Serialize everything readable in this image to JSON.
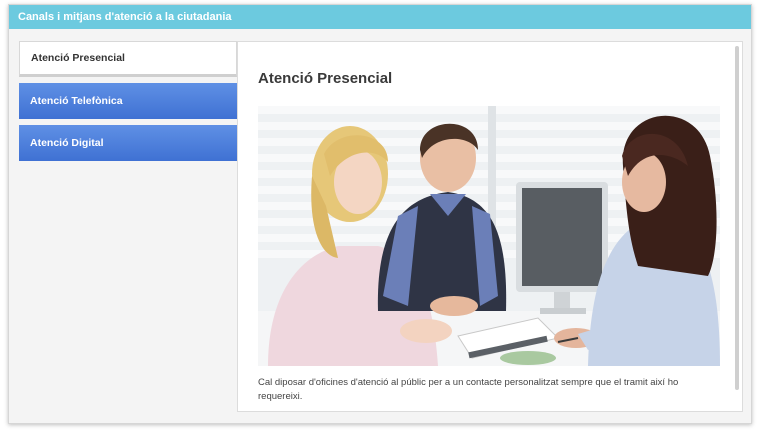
{
  "window": {
    "title": "Canals i mitjans d'atenció a la ciutadania"
  },
  "tabs": [
    {
      "label": "Atenció Presencial",
      "active": true
    },
    {
      "label": "Atenció Telefònica",
      "active": false
    },
    {
      "label": "Atenció Digital",
      "active": false
    }
  ],
  "content": {
    "title": "Atenció Presencial",
    "description": "Cal diposar d'oficines d'atenció al públic per a un contacte personalitzat sempre que el tramit així  ho requereixi."
  },
  "colors": {
    "titlebar": "#6ccadf",
    "tab_inactive": "#4a7bdb",
    "tab_active": "#ffffff"
  }
}
